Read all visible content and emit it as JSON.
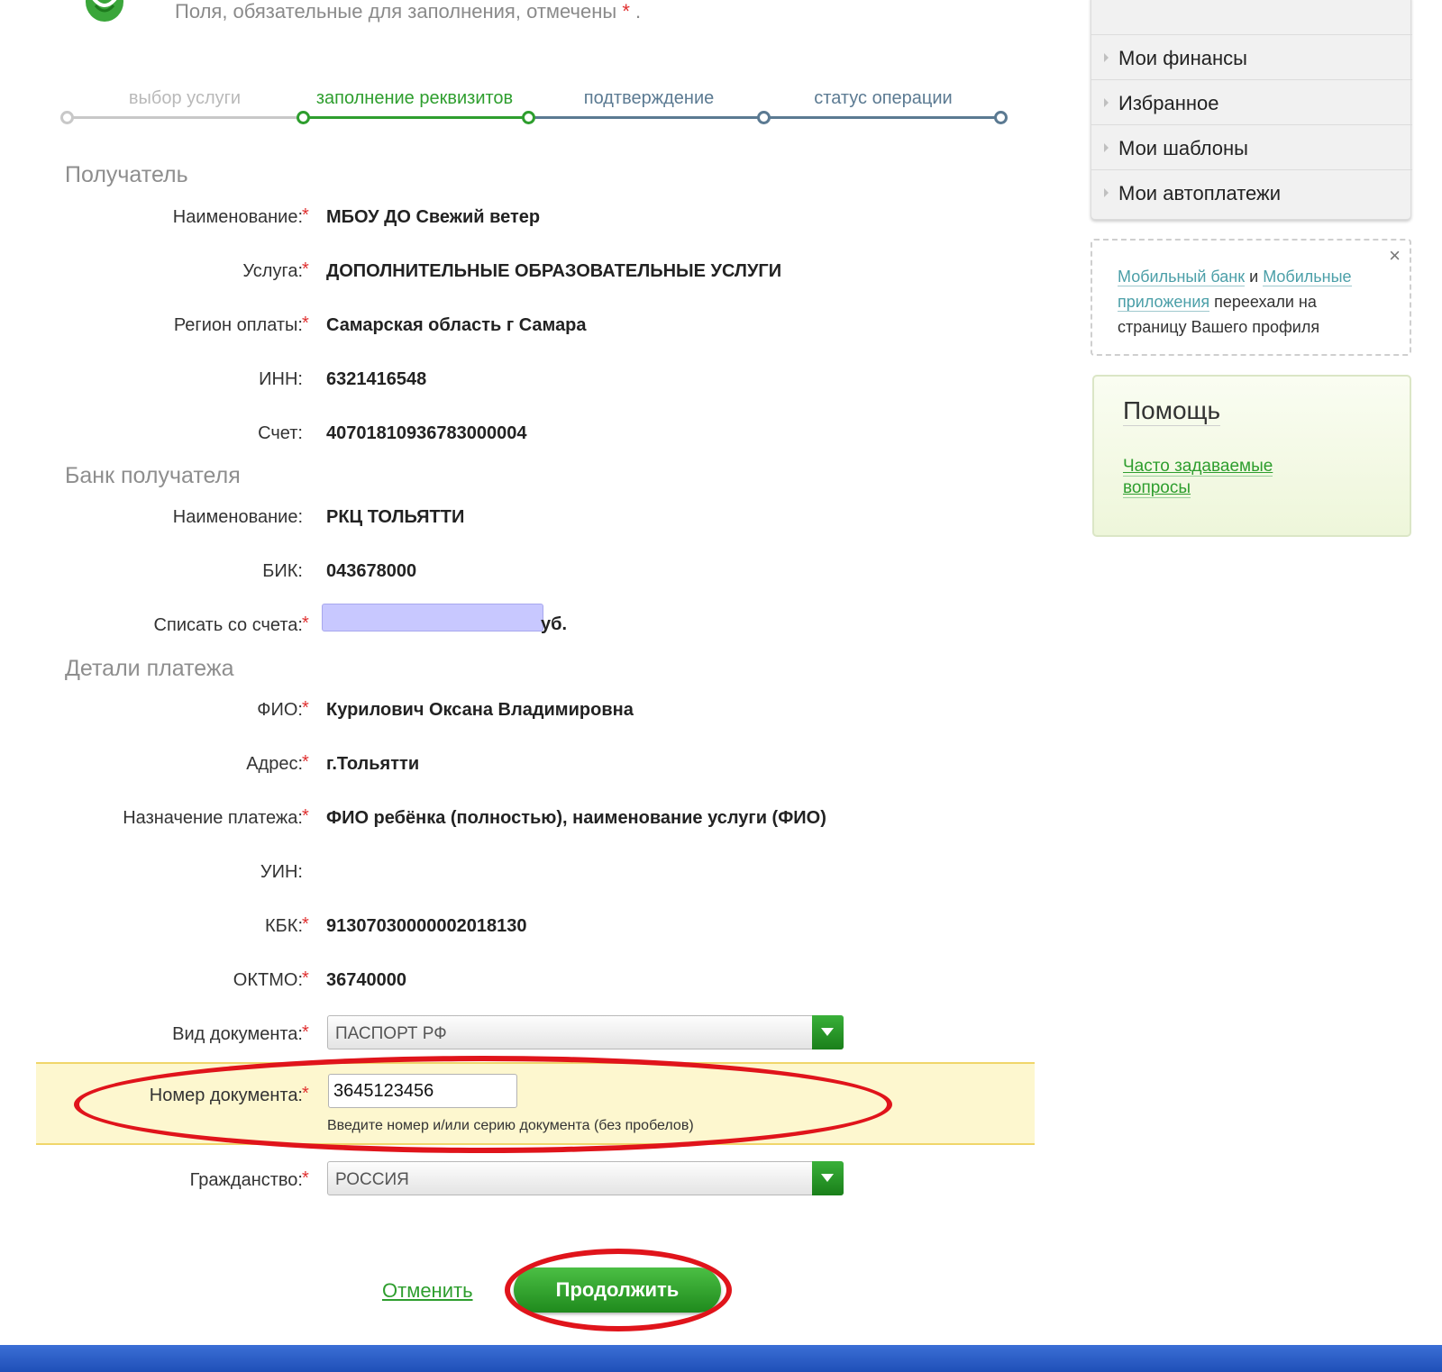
{
  "header": {
    "required_note": "Поля, обязательные для заполнения, отмечены",
    "required_star": "*",
    "required_dot": "."
  },
  "stepper": {
    "steps": [
      {
        "label": "выбор услуги",
        "state": "done"
      },
      {
        "label": "заполнение реквизитов",
        "state": "active"
      },
      {
        "label": "подтверждение",
        "state": "next"
      },
      {
        "label": "статус операции",
        "state": "next"
      }
    ],
    "colors": {
      "done": "#c8c8c8",
      "active": "#2e9e2e",
      "next": "#5b7a92"
    }
  },
  "sections": {
    "recipient": "Получатель",
    "bank": "Банк получателя",
    "details": "Детали платежа"
  },
  "recipient": {
    "name_label": "Наименование:",
    "name_value": "МБОУ ДО Свежий ветер",
    "service_label": "Услуга:",
    "service_value": "ДОПОЛНИТЕЛЬНЫЕ ОБРАЗОВАТЕЛЬНЫЕ УСЛУГИ",
    "region_label": "Регион оплаты:",
    "region_value": "Самарская область г Самара",
    "inn_label": "ИНН:",
    "inn_value": "6321416548",
    "account_label": "Счет:",
    "account_value": "40701810936783000004"
  },
  "bank": {
    "name_label": "Наименование:",
    "name_value": "РКЦ ТОЛЬЯТТИ",
    "bik_label": "БИК:",
    "bik_value": "043678000",
    "debit_label": "Списать со счета:",
    "debit_suffix": "уб."
  },
  "details": {
    "fio_label": "ФИО:",
    "fio_value": "Курилович Оксана Владимировна",
    "address_label": "Адрес:",
    "address_value": "г.Тольятти",
    "purpose_label": "Назначение платежа:",
    "purpose_value": "ФИО ребёнка (полностью), наименование услуги (ФИО)",
    "uin_label": "УИН:",
    "kbk_label": "КБК:",
    "kbk_value": "91307030000002018130",
    "oktmo_label": "ОКТМО:",
    "oktmo_value": "36740000",
    "doc_type_label": "Вид документа:",
    "doc_type_value": "ПАСПОРТ РФ",
    "doc_number_label": "Номер документа:",
    "doc_number_value": "3645123456",
    "doc_number_hint": "Введите номер и/или серию документа (без пробелов)",
    "citizenship_label": "Гражданство:",
    "citizenship_value": "РОССИЯ",
    "required_star": "*"
  },
  "actions": {
    "cancel": "Отменить",
    "continue": "Продолжить"
  },
  "sidebar": {
    "menu": [
      {
        "label": "Мои финансы"
      },
      {
        "label": "Избранное"
      },
      {
        "label": "Мои шаблоны"
      },
      {
        "label": "Мои автоплатежи"
      }
    ],
    "notice": {
      "link1": "Мобильный банк",
      "and": "и",
      "link2": "Мобильные приложения",
      "rest": "переехали на страницу Вашего профиля",
      "close": "×"
    },
    "help": {
      "title": "Помощь",
      "faq": "Часто задаваемые вопросы"
    }
  },
  "colors": {
    "accent_green": "#2e9e2e",
    "annotation_red": "#e0141b",
    "highlight_yellow": "#fdf7cf",
    "footer_blue": "#2a5cc4"
  }
}
